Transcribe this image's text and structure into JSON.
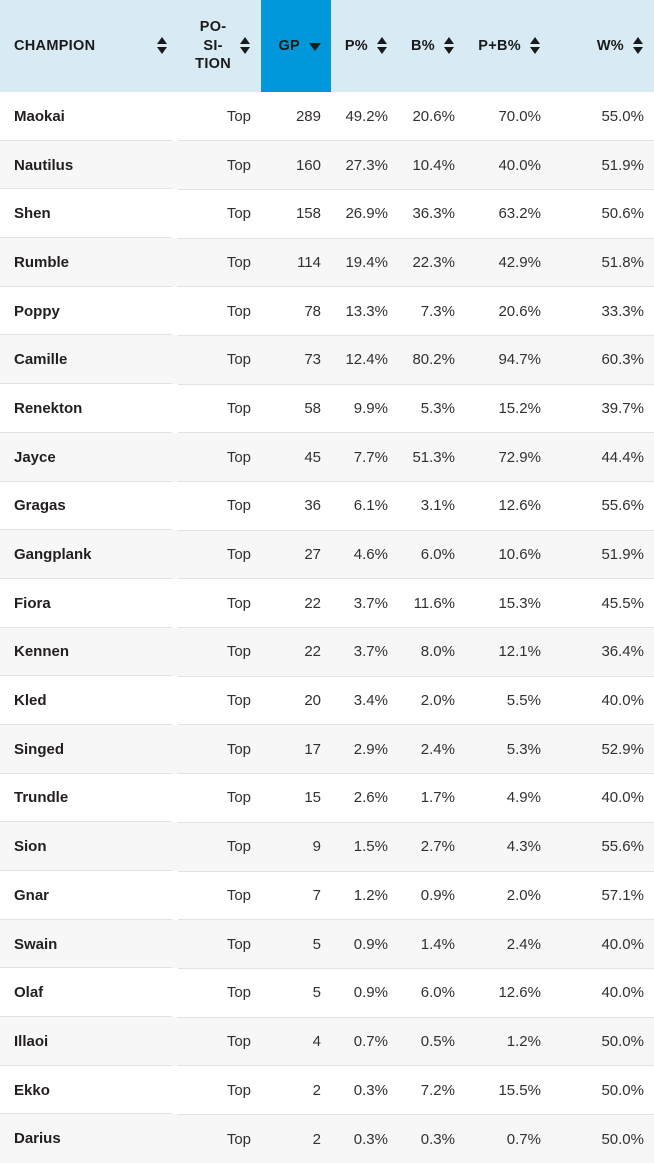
{
  "table": {
    "name": "champion-statistics",
    "colors": {
      "header_background": "#d8eaf4",
      "header_active_background": "#0098da",
      "row_background": "#ffffff",
      "row_alt_background": "#f7f7f7",
      "border": "#e2e2e2",
      "text": "#231f20"
    },
    "columns": [
      {
        "key": "champion",
        "label": "CHAMPION",
        "sort_icon": "sort-both-icon",
        "sorted": false,
        "align": "left"
      },
      {
        "key": "position",
        "label": "PO-SI-TION",
        "sort_icon": "sort-both-icon",
        "sorted": false,
        "align": "right"
      },
      {
        "key": "gp",
        "label": "GP",
        "sort_icon": "sort-desc-icon",
        "sorted": true,
        "align": "right"
      },
      {
        "key": "p",
        "label": "P%",
        "sort_icon": "sort-both-icon",
        "sorted": false,
        "align": "right"
      },
      {
        "key": "b",
        "label": "B%",
        "sort_icon": "sort-both-icon",
        "sorted": false,
        "align": "right"
      },
      {
        "key": "pb",
        "label": "P+B%",
        "sort_icon": "sort-both-icon",
        "sorted": false,
        "align": "right"
      },
      {
        "key": "w",
        "label": "W%",
        "sort_icon": "sort-both-icon",
        "sorted": false,
        "align": "right"
      }
    ],
    "rows": [
      {
        "champion": "Maokai",
        "position": "Top",
        "gp": "289",
        "p": "49.2%",
        "b": "20.6%",
        "pb": "70.0%",
        "w": "55.0%"
      },
      {
        "champion": "Nautilus",
        "position": "Top",
        "gp": "160",
        "p": "27.3%",
        "b": "10.4%",
        "pb": "40.0%",
        "w": "51.9%"
      },
      {
        "champion": "Shen",
        "position": "Top",
        "gp": "158",
        "p": "26.9%",
        "b": "36.3%",
        "pb": "63.2%",
        "w": "50.6%"
      },
      {
        "champion": "Rumble",
        "position": "Top",
        "gp": "114",
        "p": "19.4%",
        "b": "22.3%",
        "pb": "42.9%",
        "w": "51.8%"
      },
      {
        "champion": "Poppy",
        "position": "Top",
        "gp": "78",
        "p": "13.3%",
        "b": "7.3%",
        "pb": "20.6%",
        "w": "33.3%"
      },
      {
        "champion": "Camille",
        "position": "Top",
        "gp": "73",
        "p": "12.4%",
        "b": "80.2%",
        "pb": "94.7%",
        "w": "60.3%"
      },
      {
        "champion": "Renekton",
        "position": "Top",
        "gp": "58",
        "p": "9.9%",
        "b": "5.3%",
        "pb": "15.2%",
        "w": "39.7%"
      },
      {
        "champion": "Jayce",
        "position": "Top",
        "gp": "45",
        "p": "7.7%",
        "b": "51.3%",
        "pb": "72.9%",
        "w": "44.4%"
      },
      {
        "champion": "Gragas",
        "position": "Top",
        "gp": "36",
        "p": "6.1%",
        "b": "3.1%",
        "pb": "12.6%",
        "w": "55.6%"
      },
      {
        "champion": "Gangplank",
        "position": "Top",
        "gp": "27",
        "p": "4.6%",
        "b": "6.0%",
        "pb": "10.6%",
        "w": "51.9%"
      },
      {
        "champion": "Fiora",
        "position": "Top",
        "gp": "22",
        "p": "3.7%",
        "b": "11.6%",
        "pb": "15.3%",
        "w": "45.5%"
      },
      {
        "champion": "Kennen",
        "position": "Top",
        "gp": "22",
        "p": "3.7%",
        "b": "8.0%",
        "pb": "12.1%",
        "w": "36.4%"
      },
      {
        "champion": "Kled",
        "position": "Top",
        "gp": "20",
        "p": "3.4%",
        "b": "2.0%",
        "pb": "5.5%",
        "w": "40.0%"
      },
      {
        "champion": "Singed",
        "position": "Top",
        "gp": "17",
        "p": "2.9%",
        "b": "2.4%",
        "pb": "5.3%",
        "w": "52.9%"
      },
      {
        "champion": "Trundle",
        "position": "Top",
        "gp": "15",
        "p": "2.6%",
        "b": "1.7%",
        "pb": "4.9%",
        "w": "40.0%"
      },
      {
        "champion": "Sion",
        "position": "Top",
        "gp": "9",
        "p": "1.5%",
        "b": "2.7%",
        "pb": "4.3%",
        "w": "55.6%"
      },
      {
        "champion": "Gnar",
        "position": "Top",
        "gp": "7",
        "p": "1.2%",
        "b": "0.9%",
        "pb": "2.0%",
        "w": "57.1%"
      },
      {
        "champion": "Swain",
        "position": "Top",
        "gp": "5",
        "p": "0.9%",
        "b": "1.4%",
        "pb": "2.4%",
        "w": "40.0%"
      },
      {
        "champion": "Olaf",
        "position": "Top",
        "gp": "5",
        "p": "0.9%",
        "b": "6.0%",
        "pb": "12.6%",
        "w": "40.0%"
      },
      {
        "champion": "Illaoi",
        "position": "Top",
        "gp": "4",
        "p": "0.7%",
        "b": "0.5%",
        "pb": "1.2%",
        "w": "50.0%"
      },
      {
        "champion": "Ekko",
        "position": "Top",
        "gp": "2",
        "p": "0.3%",
        "b": "7.2%",
        "pb": "15.5%",
        "w": "50.0%"
      },
      {
        "champion": "Darius",
        "position": "Top",
        "gp": "2",
        "p": "0.3%",
        "b": "0.3%",
        "pb": "0.7%",
        "w": "50.0%"
      }
    ]
  }
}
